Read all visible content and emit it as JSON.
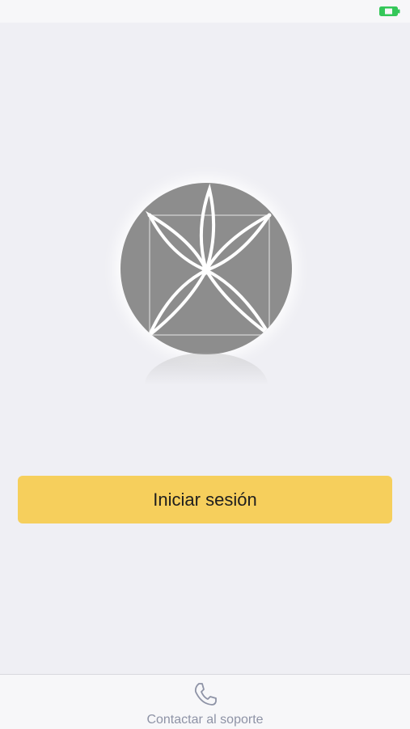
{
  "app": {
    "background": "#efeff4"
  },
  "status_bar": {
    "battery_color": "#34c759"
  },
  "logo": {
    "icon": "flower-logo-icon",
    "color": "#8d8d8d"
  },
  "login": {
    "label": "Iniciar sesión",
    "color": "#f6cf5c"
  },
  "footer": {
    "support_label": "Contactar al soporte",
    "support_icon": "phone-icon",
    "label_color": "#8e93a6"
  }
}
